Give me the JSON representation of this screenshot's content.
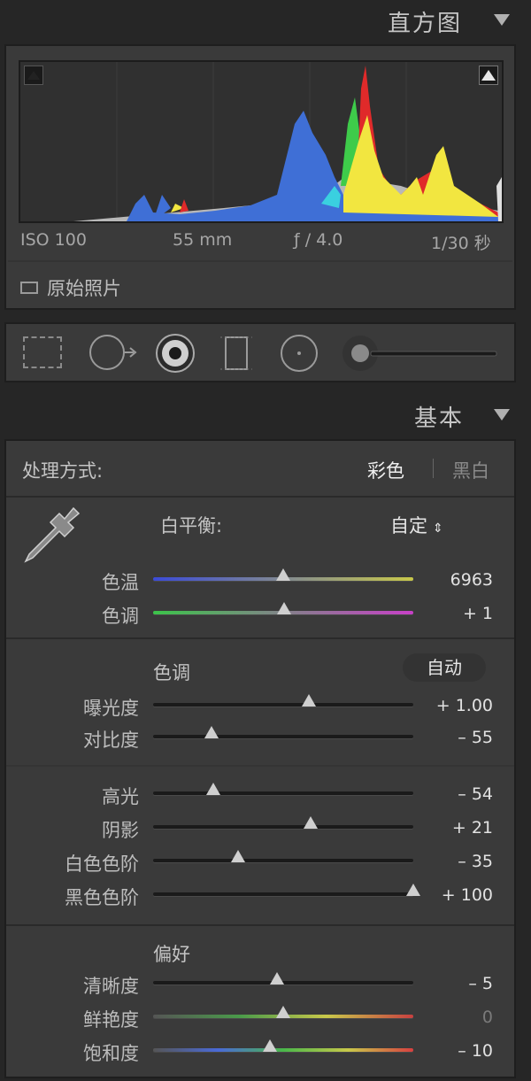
{
  "histogram": {
    "title": "直方图",
    "iso": "ISO 100",
    "focal": "55 mm",
    "aperture": "ƒ / 4.0",
    "shutter": "1/30 秒",
    "original_photo_label": "原始照片"
  },
  "tools": [
    "crop-overlay",
    "spot-removal",
    "red-eye",
    "graduated-filter",
    "radial-filter",
    "adjustment-brush"
  ],
  "basic": {
    "title": "基本",
    "treatment_label": "处理方式:",
    "treatment_color": "彩色",
    "treatment_bw": "黑白",
    "wb_label": "白平衡:",
    "wb_value": "自定",
    "temp_label": "色温",
    "temp_value": "6963",
    "tint_label": "色调",
    "tint_value": "+ 1",
    "tone_label": "色调",
    "auto_label": "自动",
    "exposure_label": "曝光度",
    "exposure_value": "+ 1.00",
    "contrast_label": "对比度",
    "contrast_value": "– 55",
    "highlights_label": "高光",
    "highlights_value": "– 54",
    "shadows_label": "阴影",
    "shadows_value": "+ 21",
    "whites_label": "白色色阶",
    "whites_value": "– 35",
    "blacks_label": "黑色色阶",
    "blacks_value": "+ 100",
    "presence_label": "偏好",
    "clarity_label": "清晰度",
    "clarity_value": "– 5",
    "vibrance_label": "鲜艳度",
    "vibrance_value": "0",
    "saturation_label": "饱和度",
    "saturation_value": "– 10"
  },
  "slider_levels": {
    "temp": 0.5,
    "tint": 0.505,
    "exposure": 0.6,
    "contrast": 0.225,
    "highlights": 0.23,
    "shadows": 0.605,
    "whites": 0.325,
    "blacks": 1.0,
    "clarity": 0.475,
    "vibrance": 0.5,
    "saturation": 0.45
  },
  "colors": {
    "panel_bg": "#3a3a3a",
    "page_bg": "#262626",
    "histogram_blue": "#3f6fd6",
    "histogram_yellow": "#f2e640",
    "histogram_red": "#e02a2a",
    "histogram_green": "#3ecb4a",
    "histogram_gray": "#b8b8b8"
  }
}
